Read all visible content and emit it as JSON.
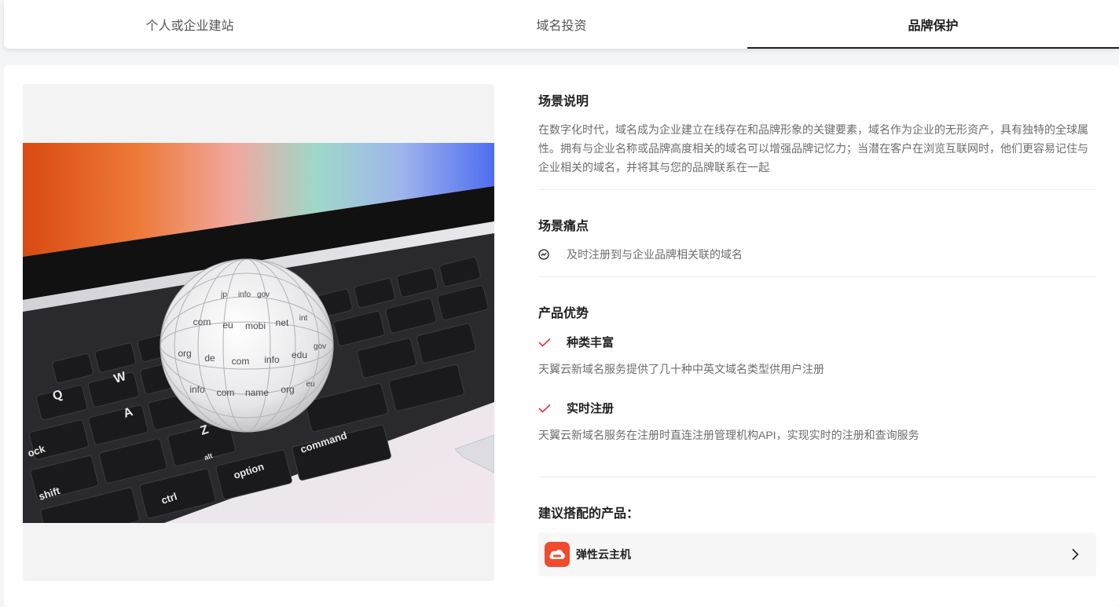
{
  "tabs": [
    {
      "label": "个人或企业建站",
      "active": false
    },
    {
      "label": "域名投资",
      "active": false
    },
    {
      "label": "品牌保护",
      "active": true
    }
  ],
  "scenario": {
    "title": "场景说明",
    "description": "在数字化时代，域名成为企业建立在线存在和品牌形象的关键要素，域名作为企业的无形资产，具有独特的全球属性。拥有与企业名称或品牌高度相关的域名可以增强品牌记忆力；当潜在客户在浏览互联网时，他们更容易记住与企业相关的域名，并将其与您的品牌联系在一起"
  },
  "pain_points": {
    "title": "场景痛点",
    "items": [
      "及时注册到与企业品牌相关联的域名"
    ]
  },
  "advantages": {
    "title": "产品优势",
    "items": [
      {
        "title": "种类丰富",
        "description": "天翼云新域名服务提供了几十种中英文域名类型供用户注册"
      },
      {
        "title": "实时注册",
        "description": "天翼云新域名服务在注册时直连注册管理机构API，实现实时的注册和查询服务"
      }
    ]
  },
  "recommended": {
    "title": "建议搭配的产品：",
    "products": [
      {
        "name": "弹性云主机",
        "icon": "cloud-server-icon"
      }
    ]
  },
  "illustration": {
    "globe_words": [
      "com",
      "eu",
      "mobi",
      "net",
      "org",
      "de",
      "com",
      "info",
      "edu",
      "gov",
      "info",
      "com",
      "name",
      "org",
      "eu",
      "jp",
      "info",
      "gov",
      "int"
    ],
    "keys": [
      "shift",
      "ctrl",
      "option",
      "alt",
      "command",
      "ock",
      "A",
      "Z",
      "Q",
      "W"
    ]
  },
  "colors": {
    "accent": "#e0323c",
    "brand": "#ef4b2c",
    "active_tab_underline": "#1f1f1f"
  }
}
